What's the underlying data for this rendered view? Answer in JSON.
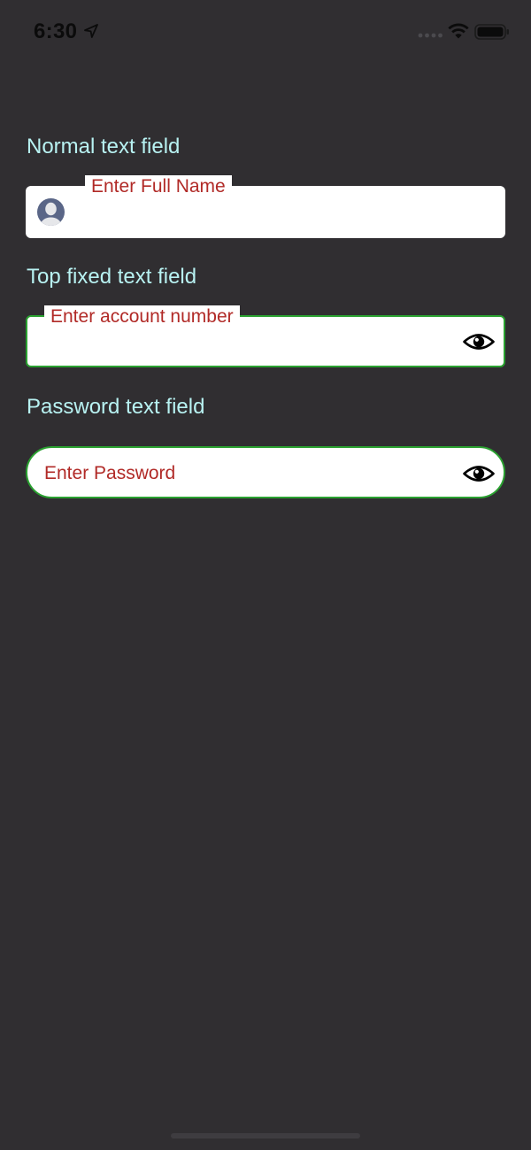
{
  "status_bar": {
    "time": "6:30",
    "icons": {
      "location": "location-arrow-icon",
      "signal": "cellular-signal-icon",
      "wifi": "wifi-icon",
      "battery": "battery-icon"
    }
  },
  "sections": {
    "normal": {
      "title": "Normal text field",
      "field_label": "Enter Full Name",
      "leading_icon": "user-avatar-icon"
    },
    "top_fixed": {
      "title": "Top fixed text field",
      "field_label": "Enter account number",
      "trailing_icon": "eye-icon"
    },
    "password": {
      "title": "Password text field",
      "placeholder": "Enter Password",
      "trailing_icon": "eye-icon"
    }
  },
  "colors": {
    "background": "#302e31",
    "section_title": "#b8f2f2",
    "field_label": "#b12a27",
    "field_border_active": "#2aa130",
    "field_background": "#ffffff"
  }
}
